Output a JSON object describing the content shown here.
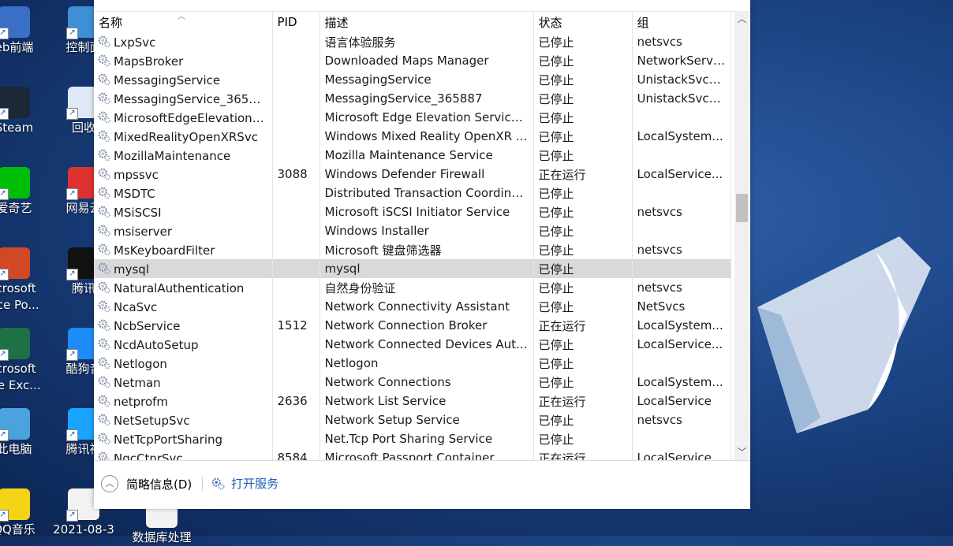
{
  "desktop": {
    "left_icons": [
      {
        "label": "eb前端",
        "color": "#3a6fc8"
      },
      {
        "label": "Steam",
        "color": "#1b2838"
      },
      {
        "label": "爱奇艺",
        "color": "#00be06"
      },
      {
        "label": "icrosoft\nfice Po...",
        "color": "#d24726"
      },
      {
        "label": "icrosoft\nice Exc...",
        "color": "#1e7145"
      },
      {
        "label": "此电脑",
        "color": "#4aa3df"
      },
      {
        "label": "QQ音乐",
        "color": "#f5d315"
      }
    ],
    "second_icons": [
      {
        "label": "控制面",
        "color": "#3f8fd6"
      },
      {
        "label": "回收",
        "color": "#dfe9f5"
      },
      {
        "label": "网易云",
        "color": "#e03131"
      },
      {
        "label": "腾讯",
        "color": "#111111"
      },
      {
        "label": "酷狗音",
        "color": "#1d8cf8"
      },
      {
        "label": "腾讯视",
        "color": "#1aa3ff"
      },
      {
        "label": "2021-08-3",
        "color": "#f2f2f2"
      }
    ],
    "bottom_icon": {
      "label": "数据库处理"
    }
  },
  "services": {
    "columns": {
      "name": "名称",
      "pid": "PID",
      "desc": "描述",
      "status": "状态",
      "group": "组"
    },
    "rows": [
      {
        "name": "LxpSvc",
        "pid": "",
        "desc": "语言体验服务",
        "status": "已停止",
        "group": "netsvcs"
      },
      {
        "name": "MapsBroker",
        "pid": "",
        "desc": "Downloaded Maps Manager",
        "status": "已停止",
        "group": "NetworkServi..."
      },
      {
        "name": "MessagingService",
        "pid": "",
        "desc": "MessagingService",
        "status": "已停止",
        "group": "UnistackSvcG..."
      },
      {
        "name": "MessagingService_365887",
        "pid": "",
        "desc": "MessagingService_365887",
        "status": "已停止",
        "group": "UnistackSvcG..."
      },
      {
        "name": "MicrosoftEdgeElevationS...",
        "pid": "",
        "desc": "Microsoft Edge Elevation Service ...",
        "status": "已停止",
        "group": ""
      },
      {
        "name": "MixedRealityOpenXRSvc",
        "pid": "",
        "desc": "Windows Mixed Reality OpenXR ...",
        "status": "已停止",
        "group": "LocalSystem..."
      },
      {
        "name": "MozillaMaintenance",
        "pid": "",
        "desc": "Mozilla Maintenance Service",
        "status": "已停止",
        "group": ""
      },
      {
        "name": "mpssvc",
        "pid": "3088",
        "desc": "Windows Defender Firewall",
        "status": "正在运行",
        "group": "LocalService..."
      },
      {
        "name": "MSDTC",
        "pid": "",
        "desc": "Distributed Transaction Coordina...",
        "status": "已停止",
        "group": ""
      },
      {
        "name": "MSiSCSI",
        "pid": "",
        "desc": "Microsoft iSCSI Initiator Service",
        "status": "已停止",
        "group": "netsvcs"
      },
      {
        "name": "msiserver",
        "pid": "",
        "desc": "Windows Installer",
        "status": "已停止",
        "group": ""
      },
      {
        "name": "MsKeyboardFilter",
        "pid": "",
        "desc": "Microsoft 键盘筛选器",
        "status": "已停止",
        "group": "netsvcs"
      },
      {
        "name": "mysql",
        "pid": "",
        "desc": "mysql",
        "status": "已停止",
        "group": "",
        "selected": true
      },
      {
        "name": "NaturalAuthentication",
        "pid": "",
        "desc": "自然身份验证",
        "status": "已停止",
        "group": "netsvcs"
      },
      {
        "name": "NcaSvc",
        "pid": "",
        "desc": "Network Connectivity Assistant",
        "status": "已停止",
        "group": "NetSvcs"
      },
      {
        "name": "NcbService",
        "pid": "1512",
        "desc": "Network Connection Broker",
        "status": "正在运行",
        "group": "LocalSystem..."
      },
      {
        "name": "NcdAutoSetup",
        "pid": "",
        "desc": "Network Connected Devices Aut...",
        "status": "已停止",
        "group": "LocalService..."
      },
      {
        "name": "Netlogon",
        "pid": "",
        "desc": "Netlogon",
        "status": "已停止",
        "group": ""
      },
      {
        "name": "Netman",
        "pid": "",
        "desc": "Network Connections",
        "status": "已停止",
        "group": "LocalSystem..."
      },
      {
        "name": "netprofm",
        "pid": "2636",
        "desc": "Network List Service",
        "status": "正在运行",
        "group": "LocalService"
      },
      {
        "name": "NetSetupSvc",
        "pid": "",
        "desc": "Network Setup Service",
        "status": "已停止",
        "group": "netsvcs"
      },
      {
        "name": "NetTcpPortSharing",
        "pid": "",
        "desc": "Net.Tcp Port Sharing Service",
        "status": "已停止",
        "group": ""
      },
      {
        "name": "NgcCtnrSvc",
        "pid": "8584",
        "desc": "Microsoft Passport Container",
        "status": "正在运行",
        "group": "LocalService..."
      }
    ]
  },
  "footer": {
    "summary_label": "简略信息(D)",
    "open_services_label": "打开服务"
  },
  "colors": {
    "selected_row": "#d9d9d9",
    "link": "#1f5fb8"
  }
}
